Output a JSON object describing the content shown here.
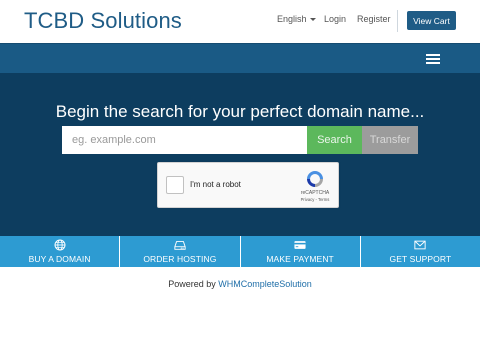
{
  "header": {
    "logo": "TCBD Solutions",
    "language": "English",
    "login": "Login",
    "register": "Register",
    "view_cart": "View Cart"
  },
  "hero": {
    "title": "Begin the search for your perfect domain name...",
    "search_placeholder": "eg. example.com",
    "search_button": "Search",
    "transfer_button": "Transfer"
  },
  "recaptcha": {
    "label": "I'm not a robot",
    "brand": "reCAPTCHA",
    "terms": "Privacy - Terms"
  },
  "shortcuts": [
    {
      "label": "BUY A DOMAIN",
      "icon": "globe-icon"
    },
    {
      "label": "ORDER HOSTING",
      "icon": "server-icon"
    },
    {
      "label": "MAKE PAYMENT",
      "icon": "credit-card-icon"
    },
    {
      "label": "GET SUPPORT",
      "icon": "envelope-icon"
    }
  ],
  "footer": {
    "prefix": "Powered by",
    "link": "WHMCompleteSolution"
  },
  "colors": {
    "brand": "#1f5c86",
    "hero": "#0d3d5f",
    "search": "#5cb85c",
    "transfer": "#9c9c9c",
    "shortcuts": "#2d9bd2"
  }
}
